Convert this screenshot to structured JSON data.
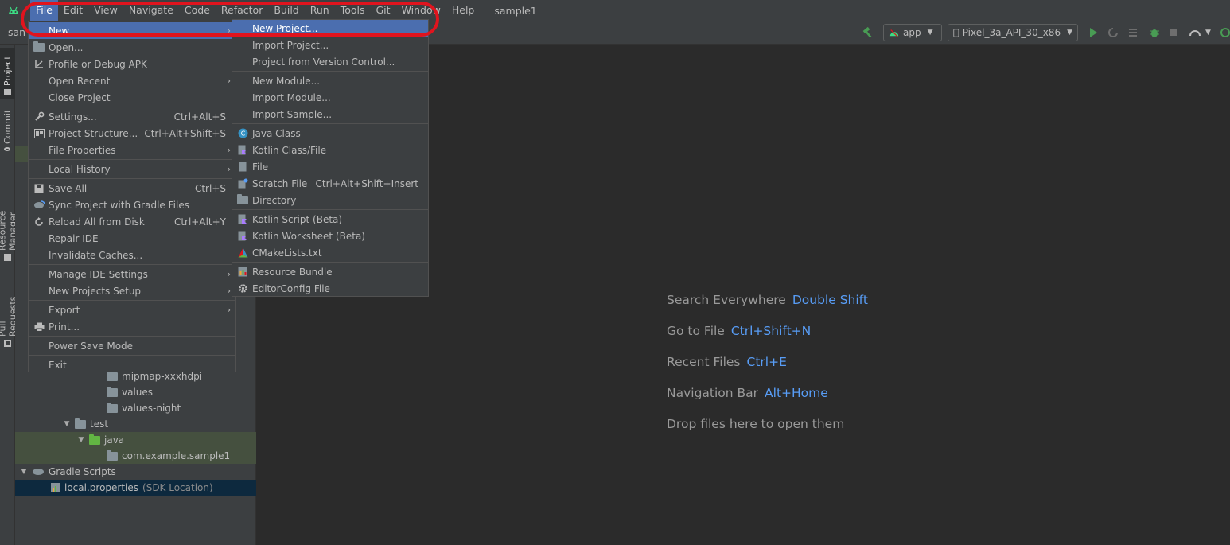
{
  "menubar": {
    "items": [
      "File",
      "Edit",
      "View",
      "Navigate",
      "Code",
      "Refactor",
      "Build",
      "Run",
      "Tools",
      "Git",
      "Window",
      "Help"
    ],
    "title": "sample1"
  },
  "toolbar": {
    "project_crumb": "san",
    "config_combo": "app",
    "device_combo": "Pixel_3a_API_30_x86"
  },
  "left_strip": {
    "tabs": [
      "Project",
      "Commit",
      "Resource Manager",
      "Pull Requests"
    ]
  },
  "project_tree": [
    {
      "label": "mipmap-xxxhdpi",
      "kind": "folder"
    },
    {
      "label": "values",
      "kind": "folder"
    },
    {
      "label": "values-night",
      "kind": "folder"
    },
    {
      "label": "test",
      "kind": "folder"
    },
    {
      "label": "java",
      "kind": "folder-green"
    },
    {
      "label": "com.example.sample1",
      "kind": "package"
    },
    {
      "label": "Gradle Scripts",
      "kind": "gradle"
    },
    {
      "label": "local.properties",
      "suffix": "(SDK Location)",
      "kind": "properties"
    }
  ],
  "file_menu": {
    "items": [
      {
        "label": "New",
        "submenu": true
      },
      {
        "label": "Open..."
      },
      {
        "label": "Profile or Debug APK"
      },
      {
        "label": "Open Recent",
        "submenu": true
      },
      {
        "label": "Close Project"
      },
      {
        "label": "Settings...",
        "shortcut": "Ctrl+Alt+S"
      },
      {
        "label": "Project Structure...",
        "shortcut": "Ctrl+Alt+Shift+S"
      },
      {
        "label": "File Properties",
        "submenu": true
      },
      {
        "label": "Local History",
        "submenu": true
      },
      {
        "label": "Save All",
        "shortcut": "Ctrl+S"
      },
      {
        "label": "Sync Project with Gradle Files"
      },
      {
        "label": "Reload All from Disk",
        "shortcut": "Ctrl+Alt+Y"
      },
      {
        "label": "Repair IDE"
      },
      {
        "label": "Invalidate Caches..."
      },
      {
        "label": "Manage IDE Settings",
        "submenu": true
      },
      {
        "label": "New Projects Setup",
        "submenu": true
      },
      {
        "label": "Export",
        "submenu": true
      },
      {
        "label": "Print..."
      },
      {
        "label": "Power Save Mode"
      },
      {
        "label": "Exit"
      }
    ]
  },
  "new_menu": {
    "items": [
      {
        "label": "New Project..."
      },
      {
        "label": "Import Project..."
      },
      {
        "label": "Project from Version Control..."
      },
      {
        "label": "New Module..."
      },
      {
        "label": "Import Module..."
      },
      {
        "label": "Import Sample..."
      },
      {
        "label": "Java Class"
      },
      {
        "label": "Kotlin Class/File"
      },
      {
        "label": "File"
      },
      {
        "label": "Scratch File",
        "shortcut": "Ctrl+Alt+Shift+Insert"
      },
      {
        "label": "Directory"
      },
      {
        "label": "Kotlin Script (Beta)"
      },
      {
        "label": "Kotlin Worksheet (Beta)"
      },
      {
        "label": "CMakeLists.txt"
      },
      {
        "label": "Resource Bundle"
      },
      {
        "label": "EditorConfig File"
      }
    ]
  },
  "editor_hints": [
    {
      "label": "Search Everywhere",
      "key": "Double Shift"
    },
    {
      "label": "Go to File",
      "key": "Ctrl+Shift+N"
    },
    {
      "label": "Recent Files",
      "key": "Ctrl+E"
    },
    {
      "label": "Navigation Bar",
      "key": "Alt+Home"
    },
    {
      "label": "Drop files here to open them",
      "key": ""
    }
  ],
  "colors": {
    "accent": "#4b6eaf",
    "highlight_ring": "#e0141e",
    "link_key": "#589df6",
    "android_green": "#3ddc84"
  }
}
